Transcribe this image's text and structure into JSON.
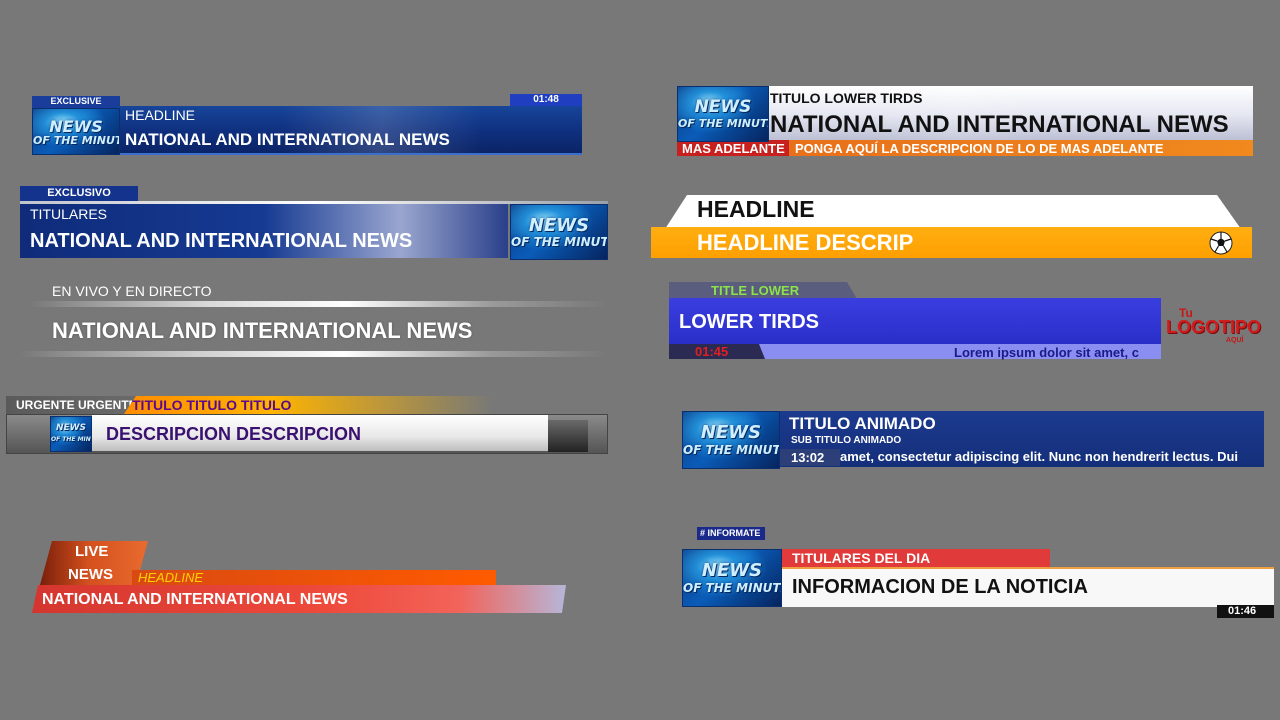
{
  "logo": {
    "line1": "NEWS",
    "line2": "OF THE MINUTE"
  },
  "lt1": {
    "tag": "EXCLUSIVE",
    "headline": "HEADLINE",
    "title": "NATIONAL AND INTERNATIONAL NEWS",
    "time": "01:48"
  },
  "lt2": {
    "tag": "EXCLUSIVO",
    "headline": "TITULARES",
    "title": "NATIONAL AND INTERNATIONAL NEWS"
  },
  "lt3": {
    "headline": "EN VIVO Y EN DIRECTO",
    "title": "NATIONAL AND INTERNATIONAL NEWS"
  },
  "lt4": {
    "tag": "URGENTE URGENTE",
    "title": "TITULO TITULO TITULO",
    "description": "DESCRIPCION DESCRIPCION"
  },
  "lt5": {
    "live_line1": "LIVE",
    "live_line2": "NEWS",
    "headline": "HEADLINE",
    "title": "NATIONAL AND INTERNATIONAL NEWS"
  },
  "rt1": {
    "headline": "TITULO LOWER TIRDS",
    "title": "NATIONAL AND INTERNATIONAL NEWS",
    "tag": "MAS ADELANTE",
    "description": "PONGA AQUÍ LA DESCRIPCION DE LO DE MAS ADELANTE"
  },
  "rt2": {
    "headline": "HEADLINE",
    "description": "HEADLINE DESCRIP"
  },
  "rt3": {
    "tag": "TITLE LOWER",
    "title": "LOWER TIRDS",
    "time": "01:45",
    "ticker": "Lorem ipsum dolor sit amet, c",
    "logo_small": "Tu",
    "logo_big": "LOGOTIPO",
    "logo_sub": "AQUÍ"
  },
  "rt4": {
    "title": "TITULO ANIMADO",
    "subtitle": "SUB TITULO ANIMADO",
    "time": "13:02",
    "ticker": "amet, consectetur adipiscing elit. Nunc non hendrerit lectus. Dui"
  },
  "rt5": {
    "tag": "# INFORMATE",
    "headline": "TITULARES DEL DIA",
    "title": "INFORMACION DE LA NOTICIA",
    "time": "01:46"
  },
  "colors": {
    "background": "#777877",
    "blue": "#0f2f7e",
    "orange": "#ffa500",
    "red": "#e03a3a"
  }
}
